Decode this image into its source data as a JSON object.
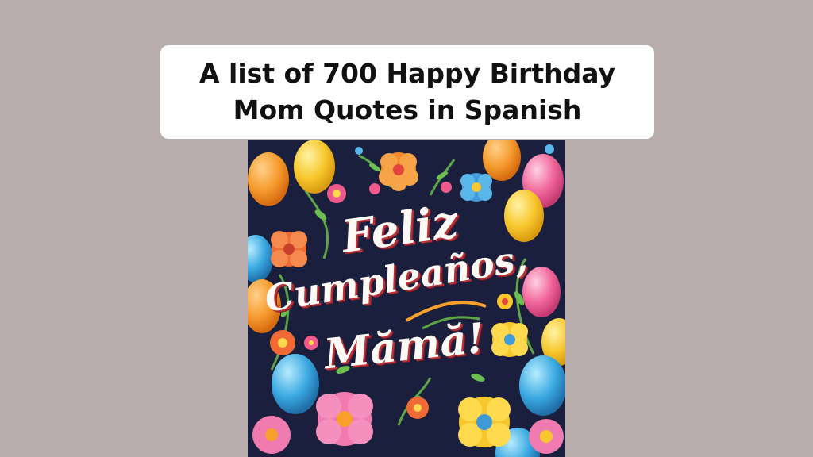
{
  "title": {
    "line1": "A list of 700 Happy Birthday",
    "line2": "Mom Quotes in Spanish"
  },
  "poster": {
    "greeting_line1": "Feliz",
    "greeting_line2": "Cumpleaños,",
    "greeting_line3": "Mămă!",
    "colors": {
      "background": "#1a1f3d",
      "text": "#fdfaf6",
      "text_shadow": "#b9323b"
    }
  }
}
